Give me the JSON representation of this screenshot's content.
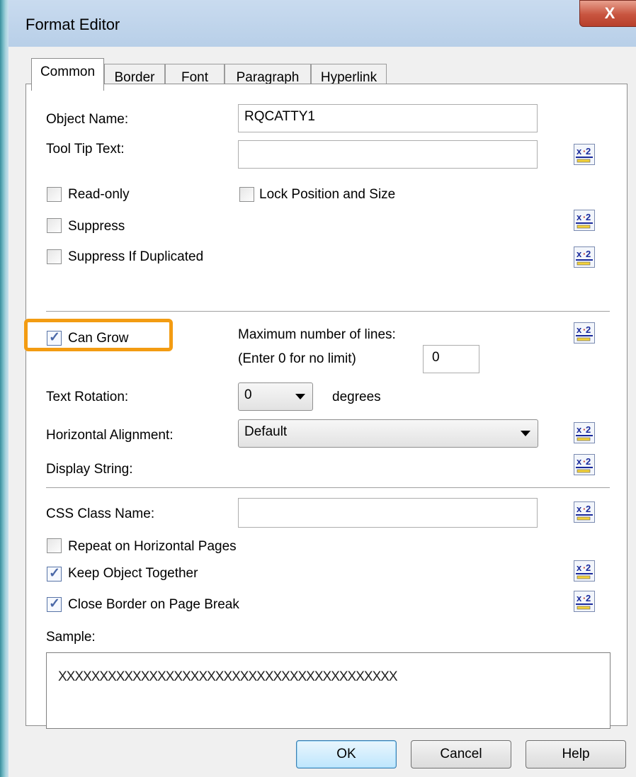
{
  "window": {
    "title": "Format Editor",
    "close_glyph": "X"
  },
  "tabs": [
    {
      "label": "Common",
      "active": true
    },
    {
      "label": "Border",
      "active": false
    },
    {
      "label": "Font",
      "active": false
    },
    {
      "label": "Paragraph",
      "active": false
    },
    {
      "label": "Hyperlink",
      "active": false
    }
  ],
  "common": {
    "object_name": {
      "label": "Object Name:",
      "value": "RQCATTY1"
    },
    "tool_tip": {
      "label": "Tool Tip Text:",
      "value": ""
    },
    "read_only": {
      "label": "Read-only",
      "checked": false
    },
    "lock_position": {
      "label": "Lock Position and Size",
      "checked": false
    },
    "suppress": {
      "label": "Suppress",
      "checked": false
    },
    "suppress_dup": {
      "label": "Suppress If Duplicated",
      "checked": false
    },
    "can_grow": {
      "label": "Can Grow",
      "checked": true
    },
    "max_lines": {
      "label": "Maximum number of lines:",
      "hint": "(Enter 0 for no limit)",
      "value": "0"
    },
    "text_rotation": {
      "label": "Text Rotation:",
      "value": "0",
      "unit": "degrees"
    },
    "horizontal_alignment": {
      "label": "Horizontal Alignment:",
      "value": "Default"
    },
    "display_string": {
      "label": "Display String:"
    },
    "css_class": {
      "label": "CSS Class Name:",
      "value": ""
    },
    "repeat_horizontal": {
      "label": "Repeat on Horizontal Pages",
      "checked": false
    },
    "keep_together": {
      "label": "Keep Object Together",
      "checked": true
    },
    "close_border": {
      "label": "Close Border on Page Break",
      "checked": true
    },
    "sample": {
      "label": "Sample:",
      "text": "XXXXXXXXXXXXXXXXXXXXXXXXXXXXXXXXXXXXXXXXX"
    }
  },
  "formula_icon_name": "formula-x2-icon",
  "highlight_color": "#f39c12",
  "buttons": {
    "ok": "OK",
    "cancel": "Cancel",
    "help": "Help"
  }
}
